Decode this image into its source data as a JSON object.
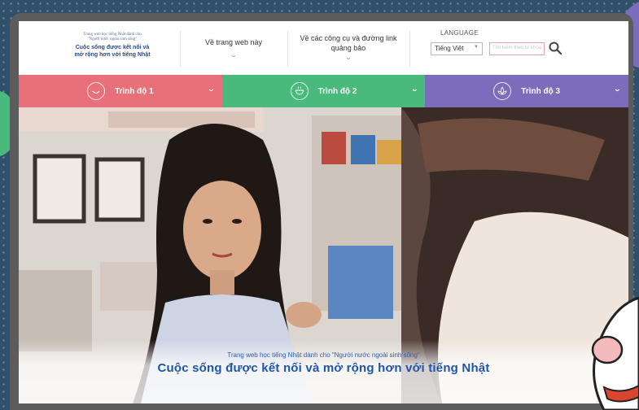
{
  "logo": {
    "small_line1": "Trang web học tiếng Nhật dành cho",
    "small_line2": "\"Người nước ngoài sinh sống\"",
    "main_line1": "Cuộc sống được kết nối và",
    "main_line2": "mở rộng hơn với tiếng Nhật"
  },
  "nav": {
    "about": "Về trang web này",
    "tools_line1": "Về các công cụ và đường link",
    "tools_line2": "quảng bảo"
  },
  "language": {
    "label": "LANGUAGE",
    "selected": "Tiếng Việt"
  },
  "search": {
    "placeholder": "Tìm kiếm theo từ khóa"
  },
  "levels": [
    {
      "label": "Trình độ 1",
      "color": "#e8707a"
    },
    {
      "label": "Trình độ 2",
      "color": "#49b97c"
    },
    {
      "label": "Trình độ 3",
      "color": "#7b6dbb"
    }
  ],
  "hero": {
    "subtitle": "Trang web học tiếng Nhật dành cho \"Người nước ngoài sinh sống\"",
    "title": "Cuộc sống được kết nối và mở rộng hơn với tiếng Nhật"
  },
  "colors": {
    "frame": "#5c5c5c",
    "background": "#2f4f6b",
    "title_blue": "#1f55a8"
  }
}
